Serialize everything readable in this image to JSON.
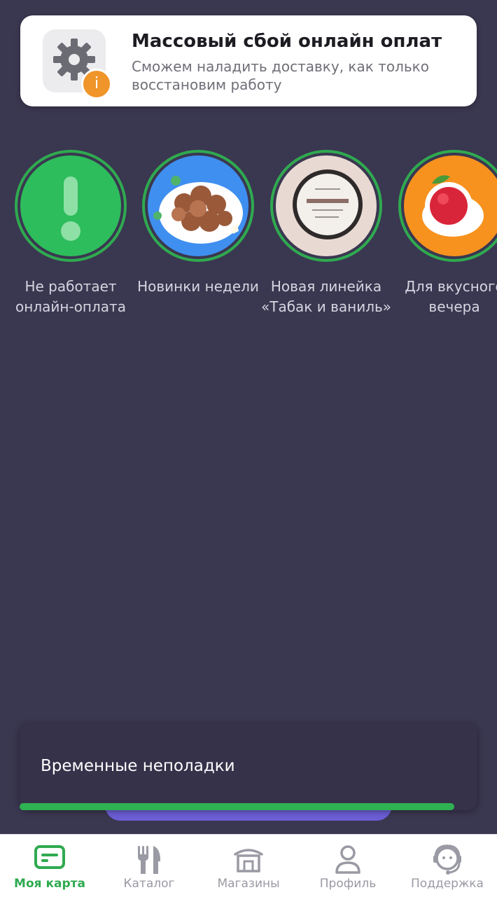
{
  "banner": {
    "title": "Массовый сбой онлайн оплат",
    "subtitle": "Сможем наладить доставку, как только восстановим работу",
    "icon": "gear-icon",
    "badge_icon": "info-icon",
    "badge_glyph": "i"
  },
  "stories": [
    {
      "label": "Не работает онлайн-оплата",
      "bg": "#2dbd5c",
      "image": "exclamation-icon"
    },
    {
      "label": "Новинки недели",
      "bg": "#3f8ff0",
      "image": "cookies-plate"
    },
    {
      "label": "Новая линейка «Табак и ваниль»",
      "bg": "#e8d9d2",
      "image": "tea-tin"
    },
    {
      "label": "Для вкусного вечера",
      "bg": "#f7921e",
      "image": "tea-cup"
    }
  ],
  "toast": {
    "message": "Временные неполадки",
    "progress": 0.95
  },
  "colors": {
    "accent": "#2faa50",
    "background": "#3a3750"
  },
  "nav": [
    {
      "label": "Моя карта",
      "icon": "card-icon",
      "active": true
    },
    {
      "label": "Каталог",
      "icon": "fork-knife-icon",
      "active": false
    },
    {
      "label": "Магазины",
      "icon": "store-icon",
      "active": false
    },
    {
      "label": "Профиль",
      "icon": "profile-icon",
      "active": false
    },
    {
      "label": "Поддержка",
      "icon": "support-icon",
      "active": false
    }
  ]
}
